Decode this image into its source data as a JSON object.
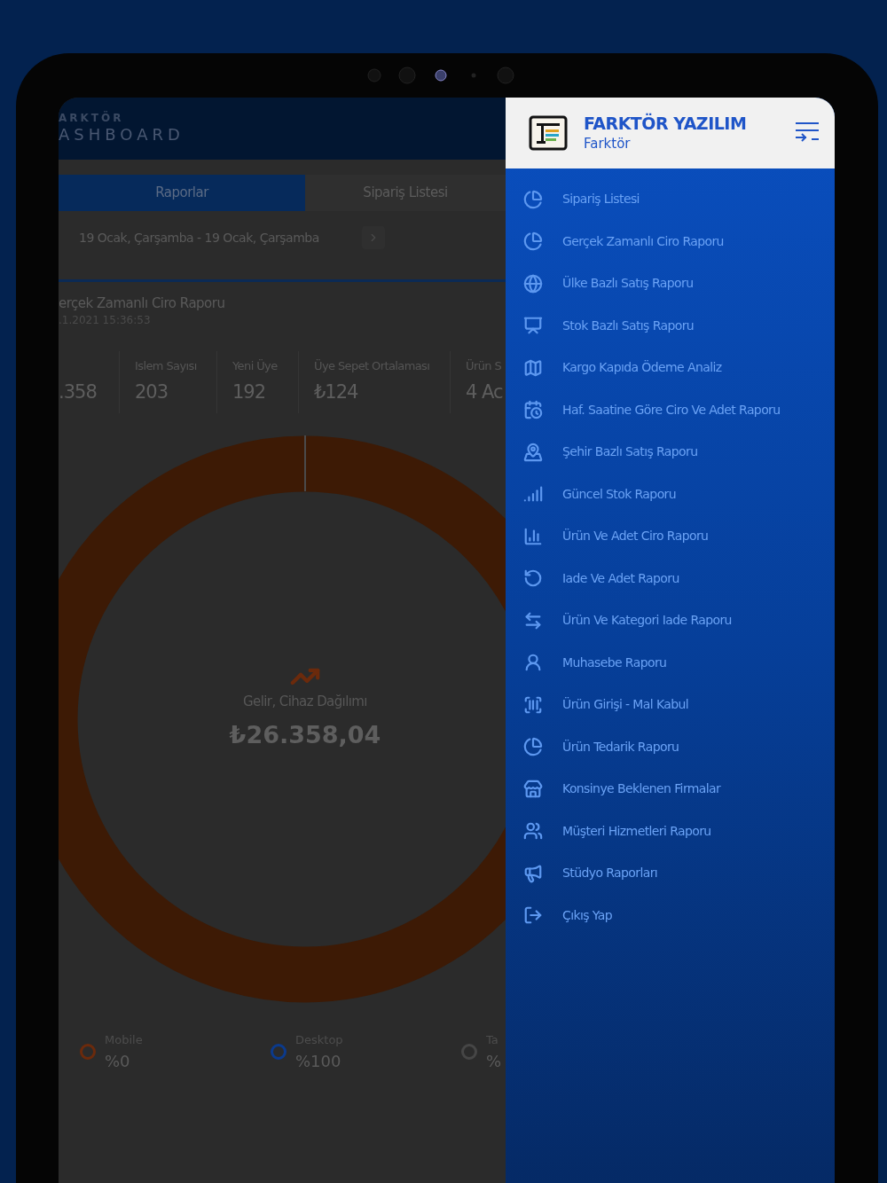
{
  "app": {
    "brand_small": "ARKTÖR",
    "brand_large": "ASHBOARD",
    "tabs": [
      {
        "label": "Raporlar",
        "selected": true
      },
      {
        "label": "Sipariş Listesi",
        "selected": false
      }
    ],
    "date_range": "19 Ocak, Çarşamba - 19 Ocak, Çarşamba",
    "report": {
      "title": "erçek Zamanlı Ciro Raporu",
      "timestamp": ".1.2021 15:36:53"
    },
    "stats": [
      {
        "value": ".358"
      },
      {
        "label": "Islem Sayısı",
        "value": "203"
      },
      {
        "label": "Yeni Üye",
        "value": "192"
      },
      {
        "label": "Üye Sepet Ortalaması",
        "value": "₺124"
      },
      {
        "label": "Ürün S",
        "value": "4 Ac"
      }
    ],
    "chart": {
      "title": "Gelir, Cihaz Dağılımı",
      "total": "₺26.358,04"
    },
    "legend": [
      {
        "label": "Mobile",
        "value": "%0",
        "color": "#6b2a0c"
      },
      {
        "label": "Desktop",
        "value": "%100",
        "color": "#0b3a8c"
      },
      {
        "label": "Ta",
        "value": "%",
        "color": "#464646"
      }
    ]
  },
  "drawer": {
    "title": "FARKTÖR YAZILIM",
    "subtitle": "Farktör",
    "items": [
      "Sipariş Listesi",
      "Gerçek Zamanlı Ciro Raporu",
      "Ülke Bazlı Satış Raporu",
      "Stok Bazlı Satış Raporu",
      "Kargo Kapıda Ödeme Analiz",
      "Haf. Saatine Göre Ciro Ve Adet Raporu",
      "Şehir Bazlı Satış Raporu",
      "Güncel Stok Raporu",
      "Ürün Ve Adet Ciro Raporu",
      "Iade Ve Adet Raporu",
      "Ürün Ve Kategori Iade Raporu",
      "Muhasebe Raporu",
      "Ürün Girişi - Mal Kabul",
      "Ürün Tedarik Raporu",
      "Konsinye Beklenen Firmalar",
      "Müşteri Hizmetleri Raporu",
      "Stüdyo Raporları",
      "Çıkış Yap"
    ]
  }
}
